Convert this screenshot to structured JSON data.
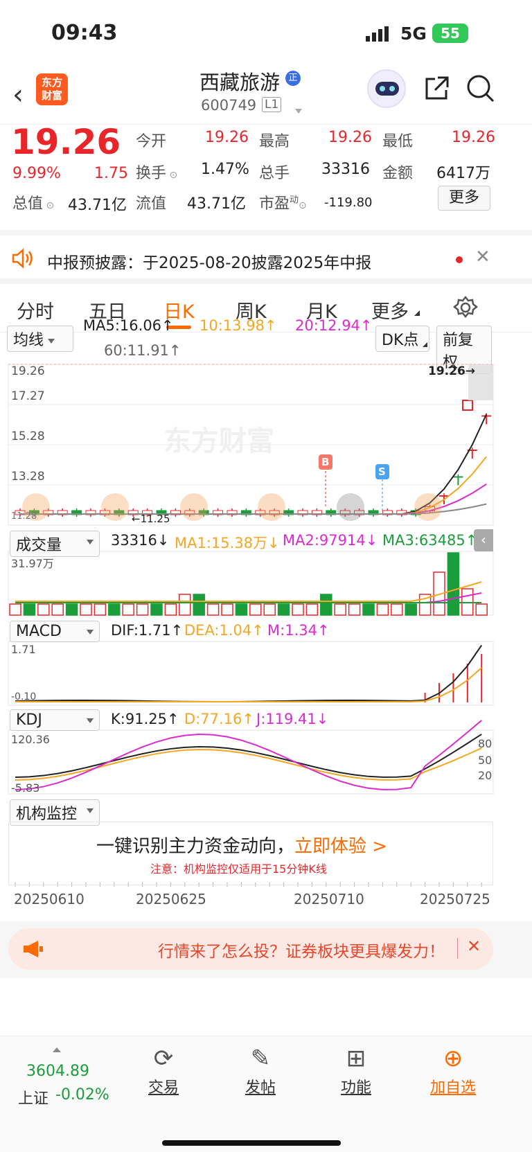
{
  "status": {
    "time": "09:43",
    "network": "5G",
    "battery": "55"
  },
  "header": {
    "logo_line1": "东方",
    "logo_line2": "财富",
    "name": "西藏旅游",
    "badge": "正",
    "code": "600749",
    "level": "L1"
  },
  "quote": {
    "price": "19.26",
    "pct": "9.99%",
    "chg": "1.75",
    "open_label": "今开",
    "open": "19.26",
    "high_label": "最高",
    "high": "19.26",
    "low_label": "最低",
    "low": "19.26",
    "turnover_label": "换手",
    "turnover": "1.47%",
    "vol_label": "总手",
    "vol": "33316",
    "amount_label": "金额",
    "amount": "6417万",
    "mcap_label": "总值",
    "mcap": "43.71亿",
    "float_label": "流值",
    "float": "43.71亿",
    "pe_label": "市盈",
    "pe_sup": "动",
    "pe": "-119.80",
    "more": "更多"
  },
  "notice": {
    "text": "中报预披露：于2025-08-20披露2025年中报"
  },
  "tabs": [
    "分时",
    "五日",
    "日K",
    "周K",
    "月K",
    "更多"
  ],
  "ma": {
    "selector": "均线",
    "ma5": "MA5:16.06↑",
    "ma10": "10:13.98↑",
    "ma20": "20:12.94↑",
    "ma60": "60:11.91↑",
    "dk": "DK点",
    "fq": "前复权"
  },
  "kline": {
    "y_top": "19.26",
    "y2": "17.27",
    "y3": "15.28",
    "y4": "13.28",
    "y_bot": "11.28",
    "low_mark": "11.25",
    "last": "19.26",
    "buy": "B",
    "sell": "S"
  },
  "volume": {
    "selector": "成交量",
    "v": "33316↓",
    "ma1": "MA1:15.38万↓",
    "ma2": "MA2:97914↓",
    "ma3": "MA3:63485↑",
    "max": "31.97万"
  },
  "macd": {
    "selector": "MACD",
    "dif": "DIF:1.71↑",
    "dea": "DEA:1.04↑",
    "m": "M:1.34↑",
    "top": "1.71",
    "bot": "-0.10"
  },
  "kdj": {
    "selector": "KDJ",
    "k": "K:91.25↑",
    "d": "D:77.16↑",
    "j": "J:119.41↓",
    "top": "120.36",
    "bot": "-5.83",
    "l80": "80",
    "l50": "50",
    "l20": "20"
  },
  "inst": {
    "selector": "机构监控",
    "title": "一键识别主力资金动向，",
    "cta": "立即体验 >",
    "note": "注意：机构监控仅适用于15分钟K线"
  },
  "dates": [
    "20250610",
    "20250625",
    "20250710",
    "20250725"
  ],
  "ad": {
    "text": "行情来了怎么投？证券板块更具爆发力！"
  },
  "bottom": {
    "index": "3604.89",
    "index_name": "上证",
    "index_chg": "-0.02%",
    "trade": "交易",
    "post": "发帖",
    "func": "功能",
    "add": "加自选"
  },
  "colors": {
    "up": "#e8262a",
    "down": "#1a9d3a",
    "ma10": "#f5a623",
    "ma20": "#d92bd0",
    "accent": "#ff6a00"
  }
}
